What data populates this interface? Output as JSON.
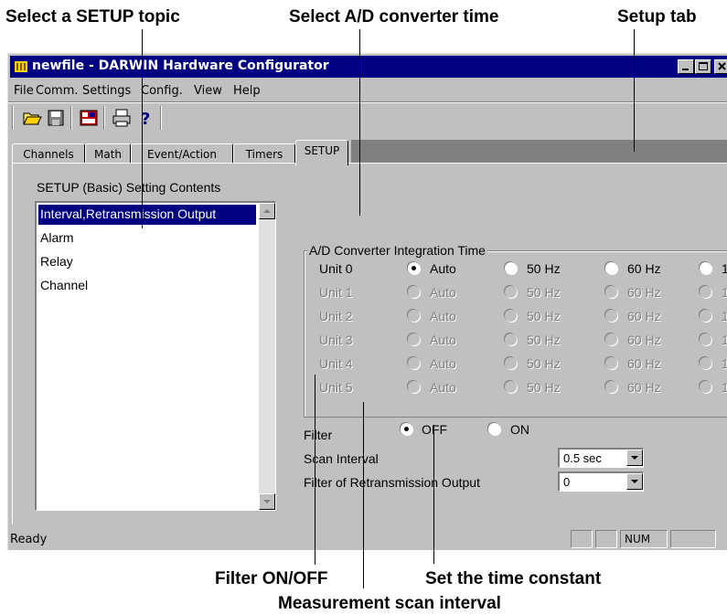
{
  "callouts": {
    "select_setup_topic": "Select a SETUP topic",
    "select_ad_time": "Select A/D converter time",
    "setup_tab": "Setup tab",
    "filter_on_off": "Filter ON/OFF",
    "set_time_constant": "Set the time constant",
    "measurement_scan_interval": "Measurement scan interval"
  },
  "window": {
    "title": "newfile - DARWIN Hardware Configurator"
  },
  "menu": {
    "file": "File",
    "comm": "Comm.",
    "settings": "Settings",
    "config": "Config.",
    "view": "View",
    "help": "Help"
  },
  "toolbar": {
    "icons": [
      "open-folder-icon",
      "save-icon",
      "hardware-icon",
      "print-icon",
      "help-icon"
    ]
  },
  "tabs": [
    "Channels",
    "Math",
    "Event/Action",
    "Timers",
    "SETUP"
  ],
  "active_tab": "SETUP",
  "setup": {
    "list_label": "SETUP (Basic) Setting Contents",
    "items": [
      "Interval,Retransmission Output",
      "Alarm",
      "Relay",
      "Channel"
    ],
    "selected_item": "Interval,Retransmission Output"
  },
  "ad_converter": {
    "title": "A/D Converter Integration Time",
    "options": [
      "Auto",
      "50 Hz",
      "60 Hz",
      "1"
    ],
    "units": [
      {
        "label": "Unit 0",
        "enabled": true,
        "selected": "Auto"
      },
      {
        "label": "Unit 1",
        "enabled": false,
        "selected": null
      },
      {
        "label": "Unit 2",
        "enabled": false,
        "selected": null
      },
      {
        "label": "Unit 3",
        "enabled": false,
        "selected": null
      },
      {
        "label": "Unit 4",
        "enabled": false,
        "selected": null
      },
      {
        "label": "Unit 5",
        "enabled": false,
        "selected": null
      }
    ]
  },
  "filter": {
    "label": "Filter",
    "off_label": "OFF",
    "on_label": "ON",
    "selected": "OFF"
  },
  "scan_interval": {
    "label": "Scan Interval",
    "value": "0.5 sec"
  },
  "retrans_filter": {
    "label": "Filter of Retransmission Output",
    "value": "0"
  },
  "status": {
    "text": "Ready",
    "num": "NUM"
  },
  "colors": {
    "title_bar": "#000080",
    "face": "#c0c0c0",
    "selection": "#000080",
    "disabled_text": "#808080"
  }
}
